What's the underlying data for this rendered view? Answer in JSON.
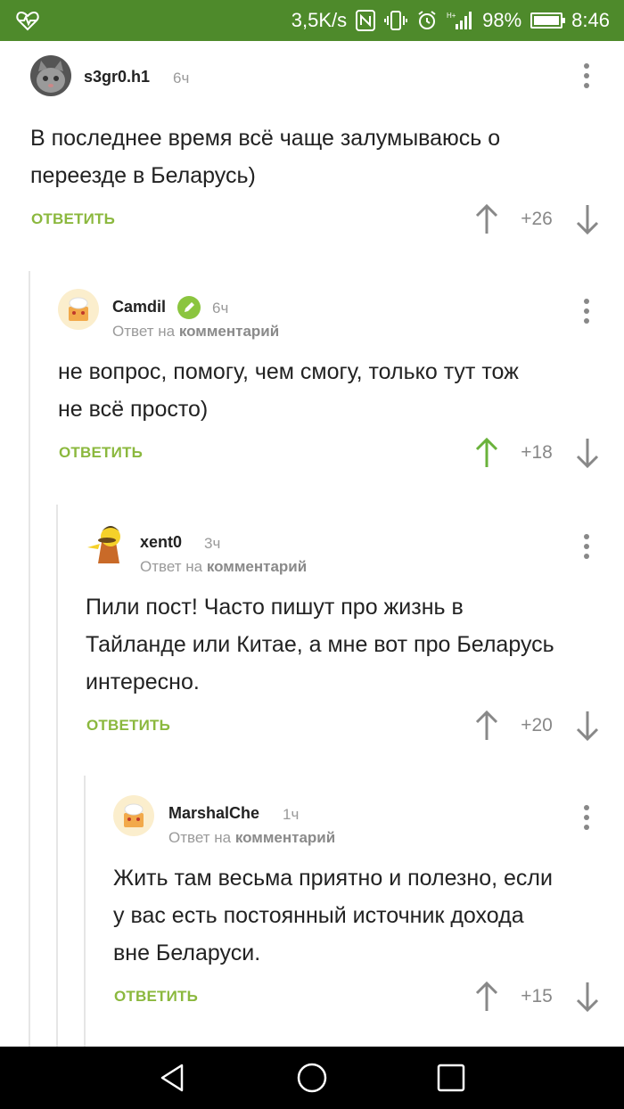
{
  "status_bar": {
    "net_speed": "3,5K/s",
    "battery": "98%",
    "time": "8:46",
    "icons": [
      "heart-pulse-icon",
      "nfc-icon",
      "vibrate-icon",
      "alarm-icon",
      "signal-icon",
      "battery-icon"
    ]
  },
  "comments": [
    {
      "username": "s3gr0.h1",
      "time": "6ч",
      "text_lines": [
        "В последнее время всё чаще залумываюсь о",
        "переезде в Беларусь)"
      ],
      "reply_label": "ОТВЕТИТЬ",
      "score": "+26",
      "upvoted": false
    },
    {
      "username": "Camdil",
      "time": "6ч",
      "reply_prefix": "Ответ на",
      "reply_target": "комментарий",
      "text_lines": [
        "не вопрос, помогу, чем смогу, только тут тож",
        "не всё просто)"
      ],
      "reply_label": "ОТВЕТИТЬ",
      "score": "+18",
      "upvoted": true
    },
    {
      "username": "xent0",
      "time": "3ч",
      "reply_prefix": "Ответ на",
      "reply_target": "комментарий",
      "text_lines": [
        "Пили пост! Часто пишут про жизнь в",
        "Тайланде или Китае, а мне вот про Беларусь",
        "интересно."
      ],
      "reply_label": "ОТВЕТИТЬ",
      "score": "+20",
      "upvoted": false
    },
    {
      "username": "MarshalChe",
      "time": "1ч",
      "reply_prefix": "Ответ на",
      "reply_target": "комментарий",
      "text_lines": [
        "Жить там весьма приятно и полезно, если",
        "у вас есть постоянный источник дохода",
        "вне Беларуси."
      ],
      "reply_label": "ОТВЕТИТЬ",
      "score": "+15",
      "upvoted": false
    }
  ],
  "colors": {
    "status_bar": "#4e8a2b",
    "accent_green": "#8bb83e",
    "upvote_active": "#6ab23b",
    "muted_text": "#9a9a9a"
  }
}
